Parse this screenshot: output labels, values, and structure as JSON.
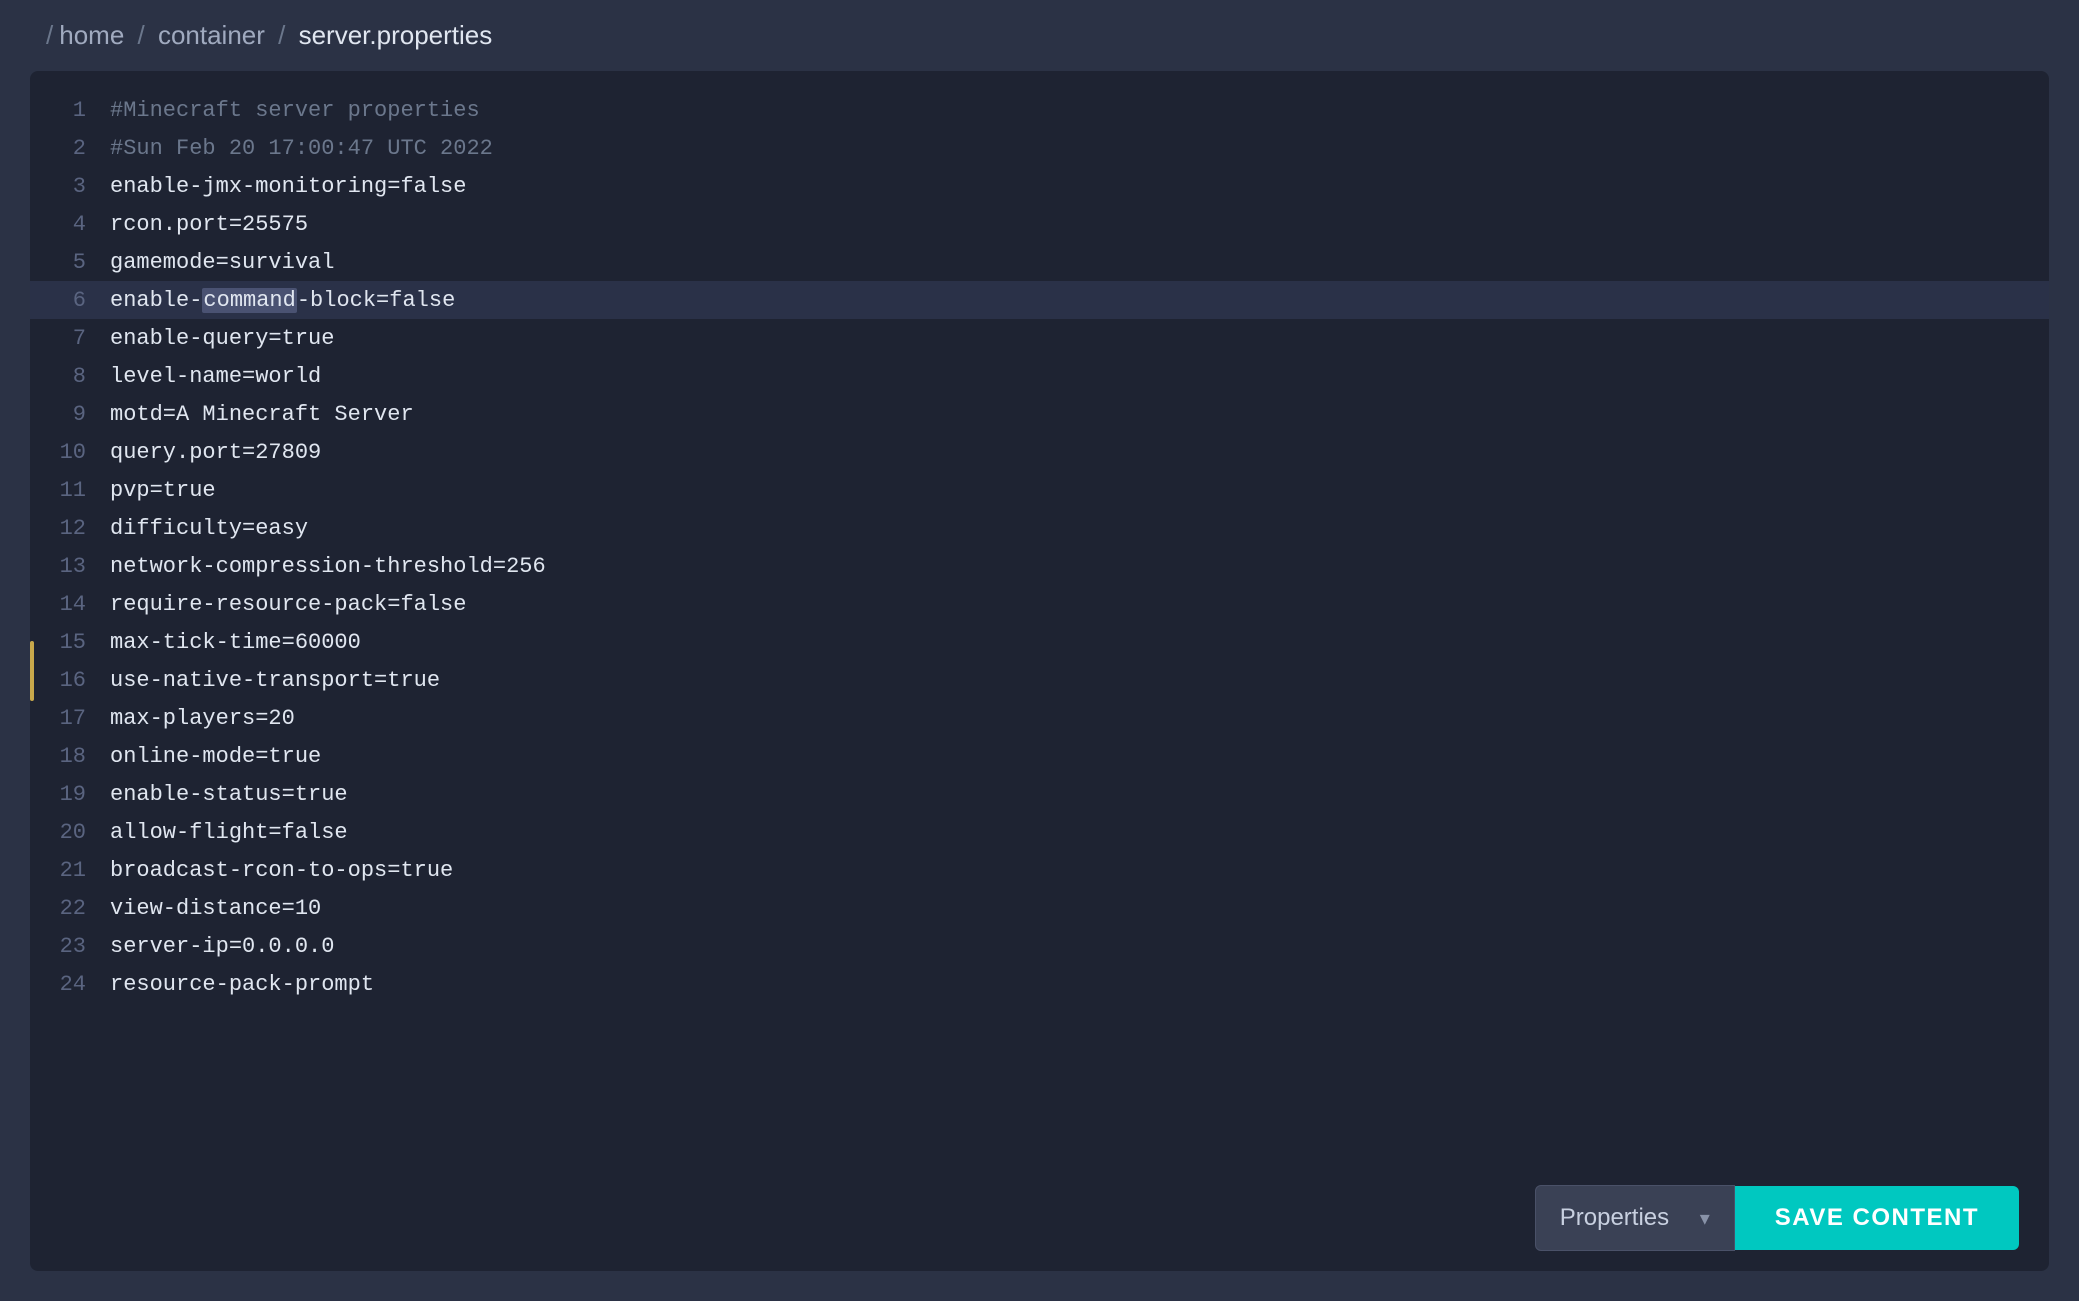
{
  "breadcrumb": {
    "separator": "/",
    "items": [
      {
        "label": "home",
        "current": false
      },
      {
        "label": "container",
        "current": false
      },
      {
        "label": "server.properties",
        "current": true
      }
    ]
  },
  "editor": {
    "lines": [
      {
        "number": 1,
        "text": "#Minecraft server properties",
        "type": "comment"
      },
      {
        "number": 2,
        "text": "#Sun Feb 20 17:00:47 UTC 2022",
        "type": "comment"
      },
      {
        "number": 3,
        "text": "enable-jmx-monitoring=false",
        "type": "code"
      },
      {
        "number": 4,
        "text": "rcon.port=25575",
        "type": "code"
      },
      {
        "number": 5,
        "text": "gamemode=survival",
        "type": "code"
      },
      {
        "number": 6,
        "text": "enable-command-block=false",
        "type": "code-highlighted",
        "highlight": "command"
      },
      {
        "number": 7,
        "text": "enable-query=true",
        "type": "code"
      },
      {
        "number": 8,
        "text": "level-name=world",
        "type": "code"
      },
      {
        "number": 9,
        "text": "motd=A Minecraft Server",
        "type": "code"
      },
      {
        "number": 10,
        "text": "query.port=27809",
        "type": "code"
      },
      {
        "number": 11,
        "text": "pvp=true",
        "type": "code"
      },
      {
        "number": 12,
        "text": "difficulty=easy",
        "type": "code"
      },
      {
        "number": 13,
        "text": "network-compression-threshold=256",
        "type": "code"
      },
      {
        "number": 14,
        "text": "require-resource-pack=false",
        "type": "code"
      },
      {
        "number": 15,
        "text": "max-tick-time=60000",
        "type": "code"
      },
      {
        "number": 16,
        "text": "use-native-transport=true",
        "type": "code"
      },
      {
        "number": 17,
        "text": "max-players=20",
        "type": "code"
      },
      {
        "number": 18,
        "text": "online-mode=true",
        "type": "code"
      },
      {
        "number": 19,
        "text": "enable-status=true",
        "type": "code"
      },
      {
        "number": 20,
        "text": "allow-flight=false",
        "type": "code"
      },
      {
        "number": 21,
        "text": "broadcast-rcon-to-ops=true",
        "type": "code"
      },
      {
        "number": 22,
        "text": "view-distance=10",
        "type": "code"
      },
      {
        "number": 23,
        "text": "server-ip=0.0.0.0",
        "type": "code"
      },
      {
        "number": 24,
        "text": "resource-pack-prompt",
        "type": "code-partial"
      }
    ]
  },
  "bottom_bar": {
    "dropdown_label": "Properties",
    "dropdown_arrow": "▾",
    "save_button_label": "SAVE CONTENT"
  }
}
